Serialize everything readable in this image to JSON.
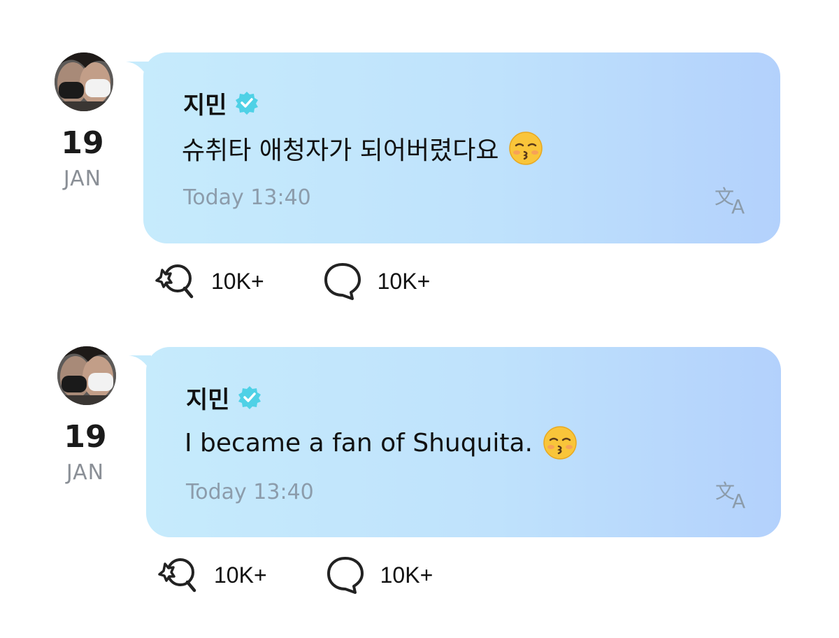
{
  "posts": [
    {
      "author": "지민",
      "verified": true,
      "date_day": "19",
      "date_month": "JAN",
      "message": "슈취타 애청자가 되어버렸다요",
      "emoji": "kissing-face-with-closed-eyes-icon",
      "time": "Today 13:40",
      "reactions": "10K+",
      "comments": "10K+"
    },
    {
      "author": "지민",
      "verified": true,
      "date_day": "19",
      "date_month": "JAN",
      "message": "I became a fan of Shuquita.",
      "emoji": "kissing-face-with-closed-eyes-icon",
      "time": "Today 13:40",
      "reactions": "10K+",
      "comments": "10K+"
    }
  ],
  "colors": {
    "bubble_start": "#c6ebfc",
    "bubble_end": "#b3d1fc",
    "verified": "#4fd1e6",
    "timestamp": "#8c9cab"
  }
}
